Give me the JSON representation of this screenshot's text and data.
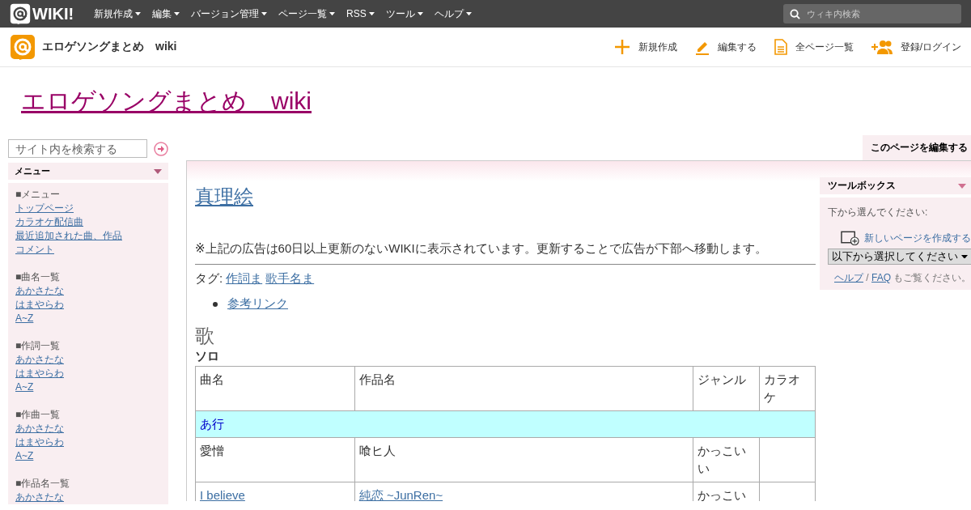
{
  "topbar": {
    "logo": "WIKI!",
    "menus": [
      "新規作成",
      "編集",
      "バージョン管理",
      "ページ一覧",
      "RSS",
      "ツール",
      "ヘルプ"
    ],
    "search": {
      "placeholder": "ウィキ内検索"
    }
  },
  "header": {
    "site_name": "エロゲソングまとめ　wiki",
    "actions": [
      {
        "kind": "plus",
        "label": "新規作成"
      },
      {
        "kind": "pencil",
        "label": "編集する"
      },
      {
        "kind": "document",
        "label": "全ページ一覧"
      },
      {
        "kind": "users",
        "label": "登録/ログイン"
      }
    ]
  },
  "site_title": "エロゲソングまとめ　wiki",
  "sidebar": {
    "search": {
      "placeholder": "サイト内を検索する"
    },
    "menu_title": "メニュー",
    "sections": [
      {
        "heading": "■メニュー",
        "links": [
          "トップページ",
          "カラオケ配信曲",
          "最近追加された曲、作品",
          "コメント"
        ]
      },
      {
        "heading": "■曲名一覧",
        "links": [
          "あかさたな",
          "はまやらわ",
          "A~Z"
        ]
      },
      {
        "heading": "■作詞一覧",
        "links": [
          "あかさたな",
          "はまやらわ",
          "A~Z"
        ]
      },
      {
        "heading": "■作曲一覧",
        "links": [
          "あかさたな",
          "はまやらわ",
          "A~Z"
        ]
      },
      {
        "heading": "■作品名一覧",
        "links": [
          "あかさたな"
        ]
      }
    ]
  },
  "edit_page_button": "このページを編集する",
  "page": {
    "title": "真理絵",
    "notice": "※上記の広告は60日以上更新のないWIKIに表示されています。更新することで広告が下部へ移動します。",
    "tags_label": "タグ:",
    "tags": [
      "作詞ま",
      "歌手名ま"
    ],
    "bullets": [
      "参考リンク"
    ],
    "section_heading": "歌",
    "subheading": "ソロ",
    "table": {
      "columns": [
        "曲名",
        "作品名",
        "ジャンル",
        "カラオケ"
      ],
      "rows": [
        {
          "kind": "group",
          "label": "あ行"
        },
        {
          "kind": "song",
          "cells": [
            {
              "text": "愛憎",
              "link": false
            },
            {
              "text": "喰ヒ人",
              "link": false
            },
            {
              "text": "かっこいい",
              "link": false
            }
          ]
        },
        {
          "kind": "song",
          "cells": [
            {
              "text": "I believe",
              "link": true
            },
            {
              "text": "純恋 ~JunRen~",
              "link": true
            },
            {
              "text": "かっこい",
              "link": false
            }
          ]
        }
      ]
    }
  },
  "toolbox": {
    "title": "ツールボックス",
    "prompt": "下から選んでください:",
    "new_page": "新しいページを作成する",
    "select": "以下から選択してください",
    "help_link": "ヘルプ",
    "separator": "/",
    "faq_link": "FAQ",
    "help_suffix": "もご覧ください。"
  }
}
